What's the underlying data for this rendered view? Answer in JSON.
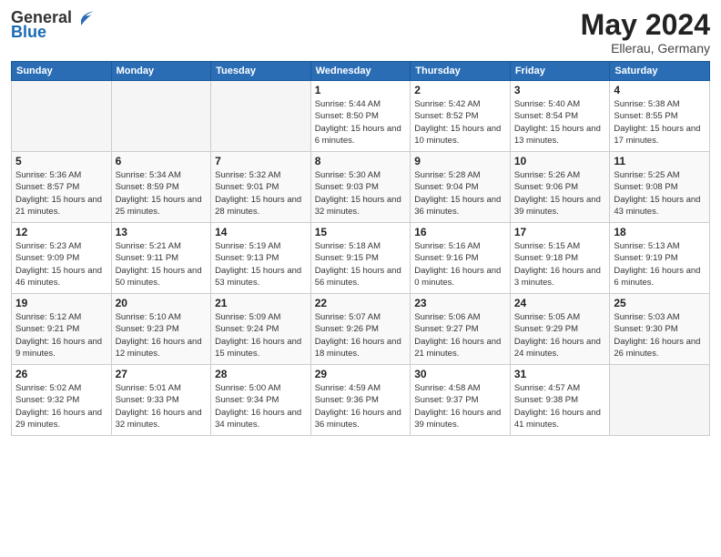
{
  "header": {
    "logo_general": "General",
    "logo_blue": "Blue",
    "month_title": "May 2024",
    "location": "Ellerau, Germany"
  },
  "days_of_week": [
    "Sunday",
    "Monday",
    "Tuesday",
    "Wednesday",
    "Thursday",
    "Friday",
    "Saturday"
  ],
  "weeks": [
    [
      {
        "day": "",
        "sunrise": "",
        "sunset": "",
        "daylight": ""
      },
      {
        "day": "",
        "sunrise": "",
        "sunset": "",
        "daylight": ""
      },
      {
        "day": "",
        "sunrise": "",
        "sunset": "",
        "daylight": ""
      },
      {
        "day": "1",
        "sunrise": "Sunrise: 5:44 AM",
        "sunset": "Sunset: 8:50 PM",
        "daylight": "Daylight: 15 hours and 6 minutes."
      },
      {
        "day": "2",
        "sunrise": "Sunrise: 5:42 AM",
        "sunset": "Sunset: 8:52 PM",
        "daylight": "Daylight: 15 hours and 10 minutes."
      },
      {
        "day": "3",
        "sunrise": "Sunrise: 5:40 AM",
        "sunset": "Sunset: 8:54 PM",
        "daylight": "Daylight: 15 hours and 13 minutes."
      },
      {
        "day": "4",
        "sunrise": "Sunrise: 5:38 AM",
        "sunset": "Sunset: 8:55 PM",
        "daylight": "Daylight: 15 hours and 17 minutes."
      }
    ],
    [
      {
        "day": "5",
        "sunrise": "Sunrise: 5:36 AM",
        "sunset": "Sunset: 8:57 PM",
        "daylight": "Daylight: 15 hours and 21 minutes."
      },
      {
        "day": "6",
        "sunrise": "Sunrise: 5:34 AM",
        "sunset": "Sunset: 8:59 PM",
        "daylight": "Daylight: 15 hours and 25 minutes."
      },
      {
        "day": "7",
        "sunrise": "Sunrise: 5:32 AM",
        "sunset": "Sunset: 9:01 PM",
        "daylight": "Daylight: 15 hours and 28 minutes."
      },
      {
        "day": "8",
        "sunrise": "Sunrise: 5:30 AM",
        "sunset": "Sunset: 9:03 PM",
        "daylight": "Daylight: 15 hours and 32 minutes."
      },
      {
        "day": "9",
        "sunrise": "Sunrise: 5:28 AM",
        "sunset": "Sunset: 9:04 PM",
        "daylight": "Daylight: 15 hours and 36 minutes."
      },
      {
        "day": "10",
        "sunrise": "Sunrise: 5:26 AM",
        "sunset": "Sunset: 9:06 PM",
        "daylight": "Daylight: 15 hours and 39 minutes."
      },
      {
        "day": "11",
        "sunrise": "Sunrise: 5:25 AM",
        "sunset": "Sunset: 9:08 PM",
        "daylight": "Daylight: 15 hours and 43 minutes."
      }
    ],
    [
      {
        "day": "12",
        "sunrise": "Sunrise: 5:23 AM",
        "sunset": "Sunset: 9:09 PM",
        "daylight": "Daylight: 15 hours and 46 minutes."
      },
      {
        "day": "13",
        "sunrise": "Sunrise: 5:21 AM",
        "sunset": "Sunset: 9:11 PM",
        "daylight": "Daylight: 15 hours and 50 minutes."
      },
      {
        "day": "14",
        "sunrise": "Sunrise: 5:19 AM",
        "sunset": "Sunset: 9:13 PM",
        "daylight": "Daylight: 15 hours and 53 minutes."
      },
      {
        "day": "15",
        "sunrise": "Sunrise: 5:18 AM",
        "sunset": "Sunset: 9:15 PM",
        "daylight": "Daylight: 15 hours and 56 minutes."
      },
      {
        "day": "16",
        "sunrise": "Sunrise: 5:16 AM",
        "sunset": "Sunset: 9:16 PM",
        "daylight": "Daylight: 16 hours and 0 minutes."
      },
      {
        "day": "17",
        "sunrise": "Sunrise: 5:15 AM",
        "sunset": "Sunset: 9:18 PM",
        "daylight": "Daylight: 16 hours and 3 minutes."
      },
      {
        "day": "18",
        "sunrise": "Sunrise: 5:13 AM",
        "sunset": "Sunset: 9:19 PM",
        "daylight": "Daylight: 16 hours and 6 minutes."
      }
    ],
    [
      {
        "day": "19",
        "sunrise": "Sunrise: 5:12 AM",
        "sunset": "Sunset: 9:21 PM",
        "daylight": "Daylight: 16 hours and 9 minutes."
      },
      {
        "day": "20",
        "sunrise": "Sunrise: 5:10 AM",
        "sunset": "Sunset: 9:23 PM",
        "daylight": "Daylight: 16 hours and 12 minutes."
      },
      {
        "day": "21",
        "sunrise": "Sunrise: 5:09 AM",
        "sunset": "Sunset: 9:24 PM",
        "daylight": "Daylight: 16 hours and 15 minutes."
      },
      {
        "day": "22",
        "sunrise": "Sunrise: 5:07 AM",
        "sunset": "Sunset: 9:26 PM",
        "daylight": "Daylight: 16 hours and 18 minutes."
      },
      {
        "day": "23",
        "sunrise": "Sunrise: 5:06 AM",
        "sunset": "Sunset: 9:27 PM",
        "daylight": "Daylight: 16 hours and 21 minutes."
      },
      {
        "day": "24",
        "sunrise": "Sunrise: 5:05 AM",
        "sunset": "Sunset: 9:29 PM",
        "daylight": "Daylight: 16 hours and 24 minutes."
      },
      {
        "day": "25",
        "sunrise": "Sunrise: 5:03 AM",
        "sunset": "Sunset: 9:30 PM",
        "daylight": "Daylight: 16 hours and 26 minutes."
      }
    ],
    [
      {
        "day": "26",
        "sunrise": "Sunrise: 5:02 AM",
        "sunset": "Sunset: 9:32 PM",
        "daylight": "Daylight: 16 hours and 29 minutes."
      },
      {
        "day": "27",
        "sunrise": "Sunrise: 5:01 AM",
        "sunset": "Sunset: 9:33 PM",
        "daylight": "Daylight: 16 hours and 32 minutes."
      },
      {
        "day": "28",
        "sunrise": "Sunrise: 5:00 AM",
        "sunset": "Sunset: 9:34 PM",
        "daylight": "Daylight: 16 hours and 34 minutes."
      },
      {
        "day": "29",
        "sunrise": "Sunrise: 4:59 AM",
        "sunset": "Sunset: 9:36 PM",
        "daylight": "Daylight: 16 hours and 36 minutes."
      },
      {
        "day": "30",
        "sunrise": "Sunrise: 4:58 AM",
        "sunset": "Sunset: 9:37 PM",
        "daylight": "Daylight: 16 hours and 39 minutes."
      },
      {
        "day": "31",
        "sunrise": "Sunrise: 4:57 AM",
        "sunset": "Sunset: 9:38 PM",
        "daylight": "Daylight: 16 hours and 41 minutes."
      },
      {
        "day": "",
        "sunrise": "",
        "sunset": "",
        "daylight": ""
      }
    ]
  ]
}
